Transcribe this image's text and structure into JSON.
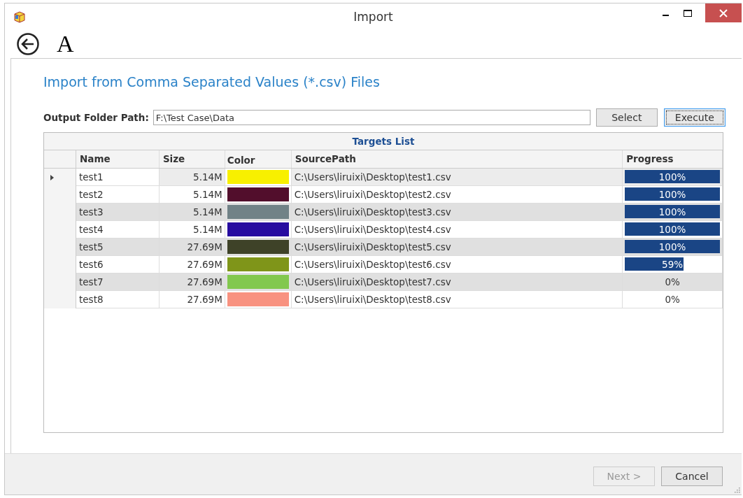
{
  "window": {
    "title": "Import"
  },
  "toolbar": {
    "letter": "A"
  },
  "heading": "Import from Comma Separated Values (*.csv) Files",
  "output_folder": {
    "label": "Output Folder Path:",
    "value": "F:\\Test Case\\Data"
  },
  "buttons": [
    {
      "label": "Select",
      "focused": false
    },
    {
      "label": "Execute",
      "focused": true
    }
  ],
  "table": {
    "title": "Targets List",
    "columns": [
      "Name",
      "Size",
      "Color",
      "SourcePath",
      "Progress"
    ],
    "rows": [
      {
        "selected": true,
        "name": "test1",
        "size": "5.14M",
        "color": "#f8f000",
        "path": "C:\\Users\\liruixi\\Desktop\\test1.csv",
        "level": 1,
        "progress": "100%"
      },
      {
        "selected": false,
        "name": "test2",
        "size": "5.14M",
        "color": "#520e2c",
        "path": "C:\\Users\\liruixi\\Desktop\\test2.csv",
        "level": 1,
        "progress": "100%"
      },
      {
        "selected": false,
        "name": "test3",
        "size": "5.14M",
        "color": "#718287",
        "path": "C:\\Users\\liruixi\\Desktop\\test3.csv",
        "level": 1,
        "progress": "100%"
      },
      {
        "selected": false,
        "name": "test4",
        "size": "5.14M",
        "color": "#270ca0",
        "path": "C:\\Users\\liruixi\\Desktop\\test4.csv",
        "level": 1,
        "progress": "100%"
      },
      {
        "selected": false,
        "name": "test5",
        "size": "27.69M",
        "color": "#3e4228",
        "path": "C:\\Users\\liruixi\\Desktop\\test5.csv",
        "level": 1,
        "progress": "100%"
      },
      {
        "selected": false,
        "name": "test6",
        "size": "27.69M",
        "color": "#7f9519",
        "path": "C:\\Users\\liruixi\\Desktop\\test6.csv",
        "level": 0.59,
        "progress": "59%"
      },
      {
        "selected": false,
        "name": "test7",
        "size": "27.69M",
        "color": "#82c84e",
        "path": "C:\\Users\\liruixi\\Desktop\\test7.csv",
        "level": 0,
        "progress": "0%"
      },
      {
        "selected": false,
        "name": "test8",
        "size": "27.69M",
        "color": "#f89280",
        "path": "C:\\Users\\liruixi\\Desktop\\test8.csv",
        "level": 0,
        "progress": "0%"
      }
    ]
  },
  "footer": [
    {
      "label": "Next >",
      "disabled": true
    },
    {
      "label": "Cancel",
      "disabled": false
    }
  ]
}
